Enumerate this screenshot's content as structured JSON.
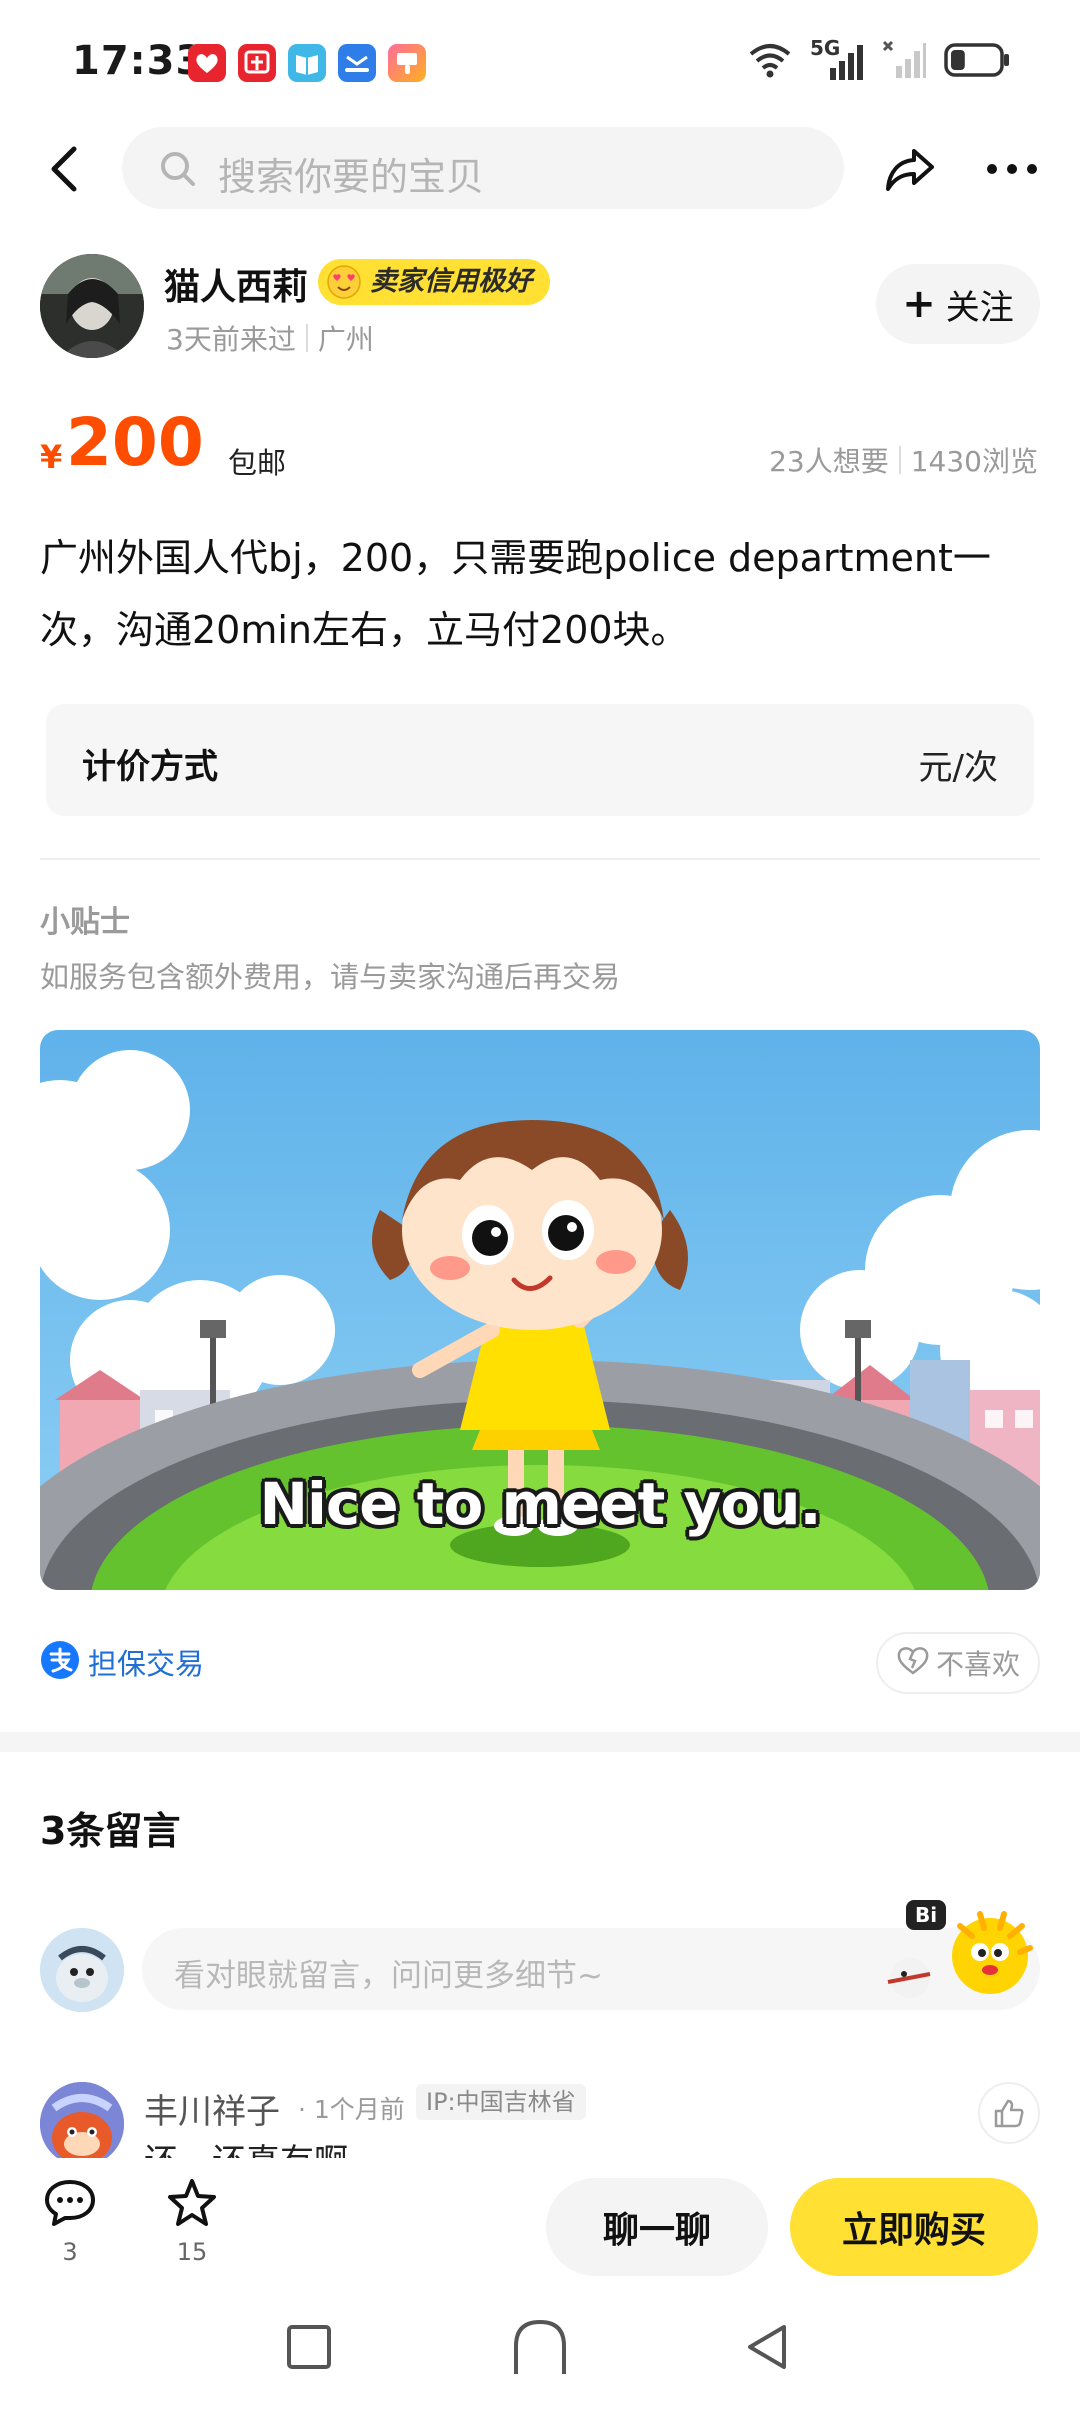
{
  "status_bar": {
    "time": "17:33",
    "network_label": "5G",
    "battery_level": 0.3
  },
  "search": {
    "placeholder": "搜索你要的宝贝"
  },
  "seller": {
    "name": "猫人西莉",
    "credit_badge": "卖家信用极好",
    "last_seen": "3天前来过",
    "location": "广州",
    "follow_label": "关注"
  },
  "price": {
    "currency": "¥",
    "amount": "200",
    "shipping": "包邮",
    "wants": "23人想要",
    "views": "1430浏览"
  },
  "description": "广州外国人代bj，200，只需要跑police department一次，沟通20min左右，立马付200块。",
  "pricing": {
    "label": "计价方式",
    "value": "元/次"
  },
  "tips": {
    "title": "小贴士",
    "text": "如服务包含额外费用，请与卖家沟通后再交易"
  },
  "image": {
    "caption": "Nice to meet you."
  },
  "guarantee": {
    "label": "担保交易",
    "dislike_label": "不喜欢"
  },
  "comments": {
    "title": "3条留言",
    "input_placeholder": "看对眼就留言，问问更多细节~",
    "mascot_text": "Bi",
    "items": [
      {
        "name": "丰川祥子",
        "time": "1个月前",
        "ip": "IP:中国吉林省",
        "text": "还，还真有啊"
      }
    ]
  },
  "bottom_bar": {
    "comment_count": "3",
    "favorite_count": "15",
    "chat_label": "聊一聊",
    "buy_label": "立即购买"
  },
  "colors": {
    "accent_yellow": "#ffe033",
    "price_orange": "#ff4d00",
    "link_blue": "#1f6fd6"
  }
}
